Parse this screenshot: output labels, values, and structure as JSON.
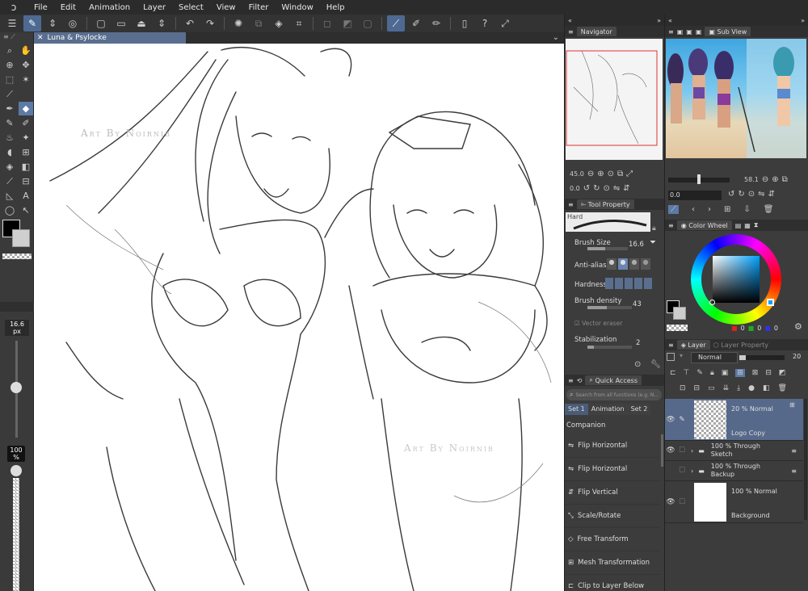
{
  "menu": [
    "File",
    "Edit",
    "Animation",
    "Layer",
    "Select",
    "View",
    "Filter",
    "Window",
    "Help"
  ],
  "document": {
    "tab_title": "Luna & Psylocke",
    "watermark": "Art By Noirnib",
    "watermark2": "Art By Noirnib"
  },
  "tools": {
    "brush_size": "16.6",
    "brush_unit": "px",
    "opacity": "100",
    "opacity_unit": "%"
  },
  "navigator": {
    "title": "Navigator",
    "zoom": "45.0"
  },
  "subview": {
    "title": "Sub View",
    "zoom": "58.1",
    "rotation": "0.0"
  },
  "tool_property": {
    "title": "Tool Property",
    "preset": "Hard",
    "brush_size_label": "Brush Size",
    "brush_size_value": "16.6",
    "anti_aliasing_label": "Anti-aliasing",
    "hardness_label": "Hardness",
    "density_label": "Brush density",
    "density_value": "43",
    "vector_eraser_label": "Vector eraser",
    "stabilization_label": "Stabilization",
    "stabilization_value": "2"
  },
  "quick_access": {
    "title": "Quick Access",
    "search_placeholder": "Search from all functions (e.g. N...",
    "sets": [
      "Set 1",
      "Animation",
      "Set 2"
    ],
    "companion": "Companion",
    "items": [
      "Flip Horizontal",
      "Flip Horizontal",
      "Flip Vertical",
      "Scale/Rotate",
      "Free Transform",
      "Mesh Transformation",
      "Clip to Layer Below"
    ]
  },
  "color_wheel": {
    "title": "Color Wheel",
    "rgb_values": [
      "0",
      "0",
      "0"
    ],
    "hue_color": "#00a0ff"
  },
  "layer_panel": {
    "tab_layer": "Layer",
    "tab_property": "Layer Property",
    "blend_mode": "Normal",
    "opacity": "20",
    "layers": [
      {
        "mode": "20 % Normal",
        "name": "Logo Copy"
      },
      {
        "mode": "100 % Through",
        "name": "Sketch"
      },
      {
        "mode": "100 % Through",
        "name": "Backup"
      },
      {
        "mode": "100 % Normal",
        "name": "Background"
      }
    ]
  },
  "colors": {
    "accent": "#5a6f8f",
    "selected_tool": "#5c7aa6",
    "panel_bg": "#3c3c3c"
  }
}
